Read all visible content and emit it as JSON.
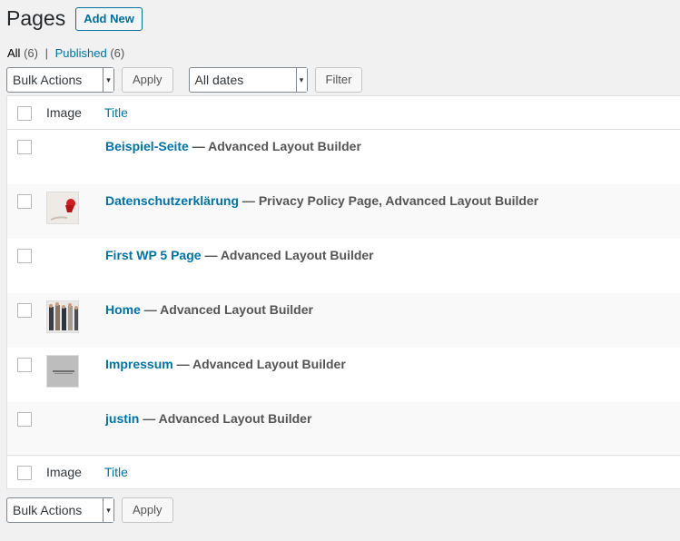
{
  "header": {
    "title": "Pages",
    "add_new": "Add New"
  },
  "views": {
    "all_label": "All",
    "all_count": "(6)",
    "separator": "|",
    "published_label": "Published",
    "published_count": "(6)"
  },
  "top_nav": {
    "bulk_actions": "Bulk Actions",
    "apply": "Apply",
    "dates": "All dates",
    "filter": "Filter"
  },
  "bottom_nav": {
    "bulk_actions": "Bulk Actions",
    "apply": "Apply"
  },
  "columns": {
    "image": "Image",
    "title": "Title"
  },
  "rows": [
    {
      "title": "Beispiel-Seite",
      "states": " — Advanced Layout Builder",
      "thumb": "none"
    },
    {
      "title": "Datenschutzerklärung",
      "states": " — Privacy Policy Page, Advanced Layout Builder",
      "thumb": "red-object"
    },
    {
      "title": "First WP 5 Page",
      "states": " — Advanced Layout Builder",
      "thumb": "none"
    },
    {
      "title": "Home",
      "states": " — Advanced Layout Builder",
      "thumb": "people"
    },
    {
      "title": "Impressum",
      "states": " — Advanced Layout Builder",
      "thumb": "grey-card"
    },
    {
      "title": "justin",
      "states": " — Advanced Layout Builder",
      "thumb": "none"
    }
  ]
}
